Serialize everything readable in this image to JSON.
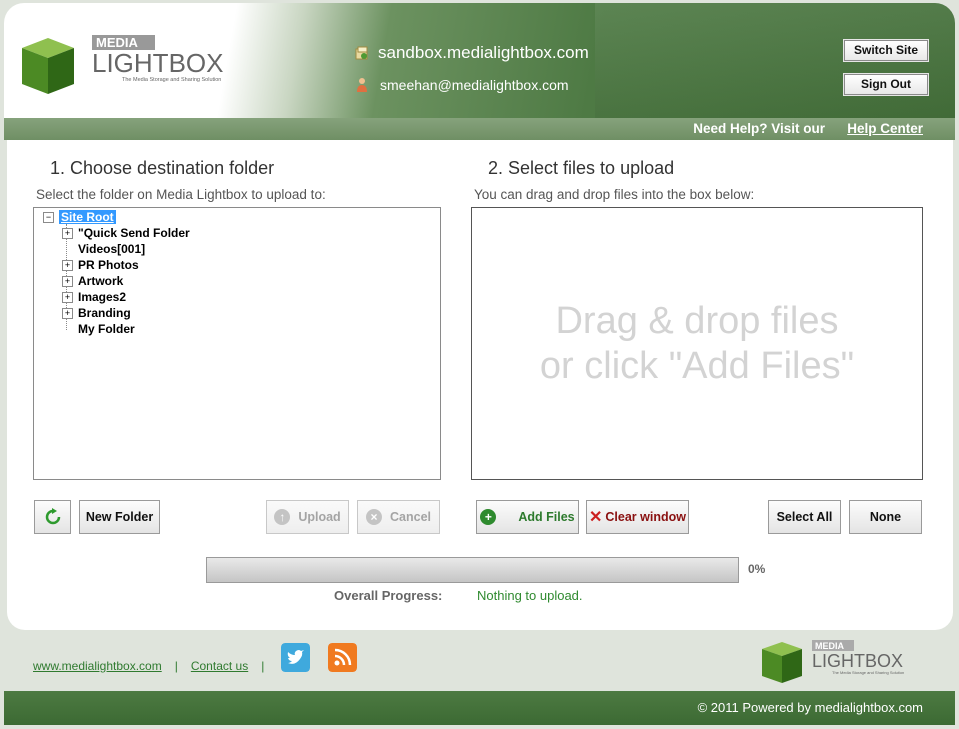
{
  "header": {
    "logo": {
      "top": "MEDIA",
      "main": "LIGHTBOX",
      "tagline": "The Media Storage and Sharing Solution",
      "icon": "cube-logo-icon"
    },
    "site_url": "sandbox.medialightbox.com",
    "user_email": "smeehan@medialightbox.com",
    "switch_site_label": "Switch Site",
    "sign_out_label": "Sign Out"
  },
  "helpbar": {
    "text": "Need Help? Visit our",
    "link": "Help Center"
  },
  "left": {
    "title": "1. Choose destination folder",
    "subtitle": "Select the folder on Media Lightbox to upload to:",
    "tree": {
      "root": "Site Root",
      "items": [
        {
          "label": "\"Quick Send Folder",
          "expandable": true
        },
        {
          "label": "Videos[001]",
          "expandable": false
        },
        {
          "label": "PR Photos",
          "expandable": true
        },
        {
          "label": "Artwork",
          "expandable": true
        },
        {
          "label": "Images2",
          "expandable": true
        },
        {
          "label": "Branding",
          "expandable": true
        },
        {
          "label": "My Folder",
          "expandable": false
        }
      ]
    },
    "buttons": {
      "refresh_icon": "refresh-icon",
      "new_folder": "New Folder",
      "upload": "Upload",
      "cancel": "Cancel"
    }
  },
  "right": {
    "title": "2. Select files to upload",
    "subtitle": "You can drag and drop files into the box below:",
    "drop_line1": "Drag & drop files",
    "drop_line2": "or click \"Add Files\"",
    "buttons": {
      "add_files": "Add Files",
      "clear_window": "Clear window",
      "select_all": "Select All",
      "none": "None"
    }
  },
  "progress": {
    "value_fraction": 0,
    "percent_label": "0%",
    "overall_label": "Overall Progress:",
    "status": "Nothing to upload."
  },
  "footer": {
    "site_link": "www.medialightbox.com",
    "contact_link": "Contact us",
    "separator": "|",
    "social": [
      "twitter-icon",
      "rss-icon"
    ],
    "copyright": "© 2011 Powered by medialightbox.com"
  },
  "colors": {
    "brand_green": "#4e7a44",
    "status_green": "#2f8a2f",
    "tree_selected": "#3399ff"
  }
}
